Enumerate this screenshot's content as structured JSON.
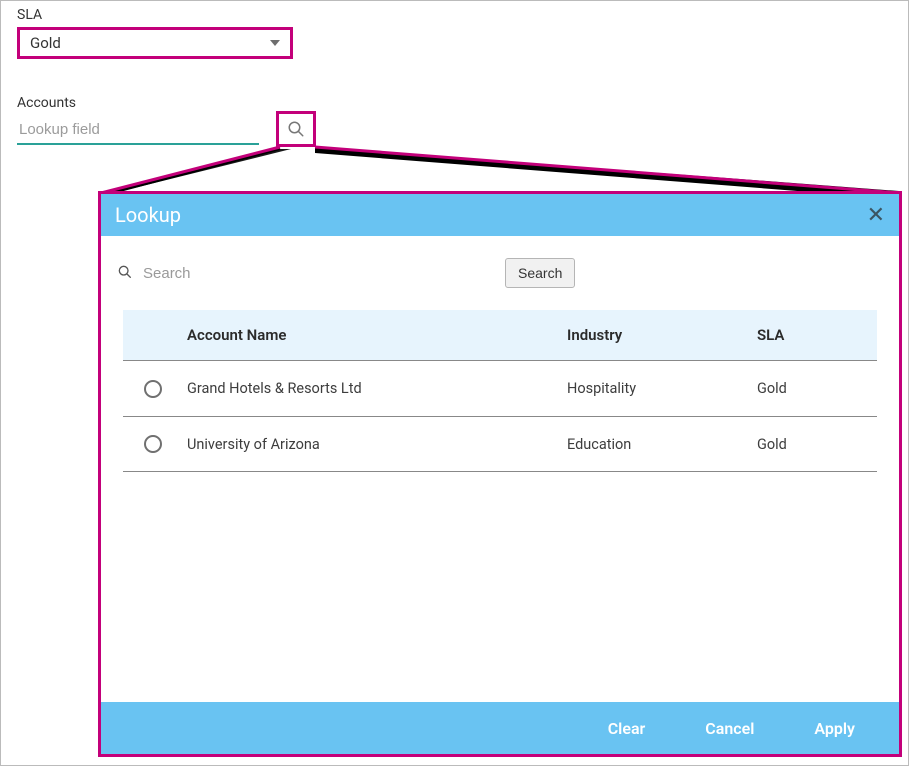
{
  "sla": {
    "label": "SLA",
    "value": "Gold"
  },
  "accounts": {
    "label": "Accounts",
    "placeholder": "Lookup field"
  },
  "modal": {
    "title": "Lookup",
    "search_placeholder": "Search",
    "search_button": "Search",
    "columns": {
      "name": "Account Name",
      "industry": "Industry",
      "sla": "SLA"
    },
    "rows": [
      {
        "name": "Grand Hotels & Resorts Ltd",
        "industry": "Hospitality",
        "sla": "Gold"
      },
      {
        "name": "University of Arizona",
        "industry": "Education",
        "sla": "Gold"
      }
    ],
    "footer": {
      "clear": "Clear",
      "cancel": "Cancel",
      "apply": "Apply"
    }
  }
}
